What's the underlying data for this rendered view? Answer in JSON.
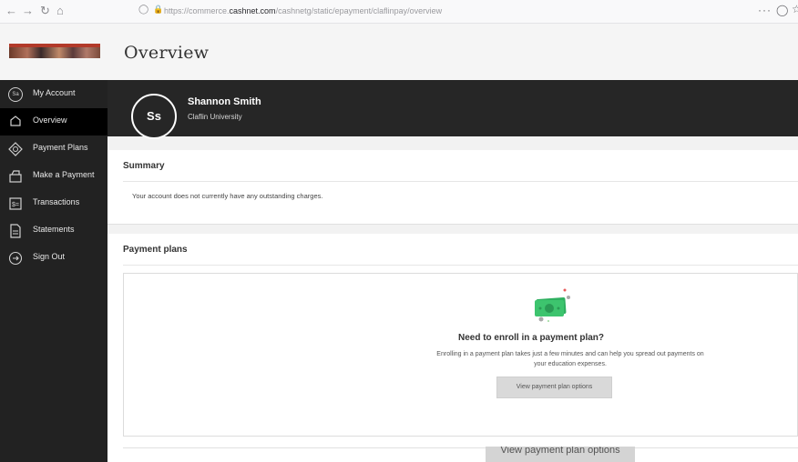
{
  "browser": {
    "url_prefix": "https://commerce.",
    "url_domain": "cashnet.com",
    "url_path": "/cashnetg/static/epayment/claflinpay/overview"
  },
  "brand": {
    "accent": "#b23a2a"
  },
  "sidebar": {
    "items": [
      {
        "label": "My Account",
        "icon": "account-circle-icon"
      },
      {
        "label": "Overview",
        "icon": "home-icon"
      },
      {
        "label": "Payment Plans",
        "icon": "payment-plans-icon"
      },
      {
        "label": "Make a Payment",
        "icon": "make-payment-icon"
      },
      {
        "label": "Transactions",
        "icon": "transactions-icon"
      },
      {
        "label": "Statements",
        "icon": "statements-icon"
      },
      {
        "label": "Sign Out",
        "icon": "sign-out-icon"
      }
    ],
    "active_index": 1
  },
  "header": {
    "title": "Overview"
  },
  "profile": {
    "initials": "Ss",
    "name": "Shannon Smith",
    "school": "Claflin University"
  },
  "summary": {
    "title": "Summary",
    "message": "Your account does not currently have any outstanding charges."
  },
  "payment_plans": {
    "title": "Payment plans",
    "heading": "Need to enroll in a payment plan?",
    "description": "Enrolling in a payment plan takes just a few minutes and can help you spread out payments on your education expenses.",
    "button_label": "View payment plan options"
  },
  "overlay_button_label": "View payment plan options"
}
